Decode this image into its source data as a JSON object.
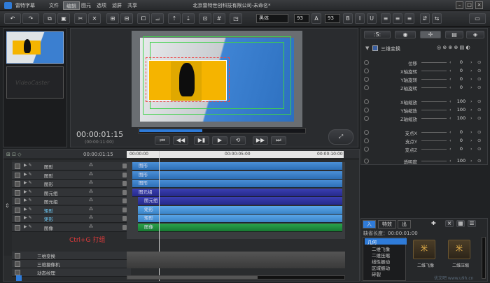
{
  "app": {
    "name": "雷特字幕",
    "window_title": "北京雷特世创科技有限公司-未命名*"
  },
  "menu": [
    "文件",
    "编辑",
    "图元",
    "选项",
    "滤屏",
    "共享"
  ],
  "toolbar": {
    "font": "黑体",
    "size1": "93",
    "size2": "93"
  },
  "preview": {
    "timecode": "00:00:01:15",
    "sub_timecode": "(00:00:11:00)",
    "thumb_watermark": "VideoCaster"
  },
  "properties": {
    "title": "三维变换",
    "rows": [
      {
        "label": "位移",
        "value": "0"
      },
      {
        "label": "X轴旋转",
        "value": "0"
      },
      {
        "label": "Y轴旋转",
        "value": "0"
      },
      {
        "label": "Z轴旋转",
        "value": "0"
      },
      {
        "label": "X轴缩放",
        "value": "100"
      },
      {
        "label": "Y轴缩放",
        "value": "100"
      },
      {
        "label": "Z轴缩放",
        "value": "100"
      },
      {
        "label": "支点X",
        "value": "0"
      },
      {
        "label": "支点Y",
        "value": "0"
      },
      {
        "label": "支点Z",
        "value": "0"
      },
      {
        "label": "透明度",
        "value": "100"
      }
    ]
  },
  "timeline": {
    "current_time": "00:00:01:15",
    "ruler": [
      "00:00:00",
      "00:00:05:00",
      "00:00:10:00"
    ],
    "layers": [
      "图形",
      "图形",
      "图形",
      "图元组",
      "图元组",
      "矩形",
      "矩形",
      "图像"
    ],
    "tracks": [
      "图形",
      "图形",
      "图形",
      "图元组",
      "图元组",
      "矩形",
      "矩形",
      "图像"
    ],
    "annotation": "Ctrl+G 打组",
    "extra_layers": [
      "三维变换",
      "三维摄像机",
      "动态纹理"
    ]
  },
  "library": {
    "tabs": [
      "入",
      "特效",
      "出"
    ],
    "duration_label": "缺省长度：00:00:01:00",
    "categories": [
      "几何",
      "二维飞像",
      "二维压缩",
      "线性振动",
      "区域振动",
      "碎裂"
    ],
    "items": [
      {
        "label": "二维飞像"
      },
      {
        "label": "二维压缩"
      }
    ],
    "watermark": "优文吧 www.u9h.cn"
  },
  "colors": {
    "accent": "#2f7bd8",
    "orange": "#f5b400",
    "annotation": "#e23b3b"
  }
}
